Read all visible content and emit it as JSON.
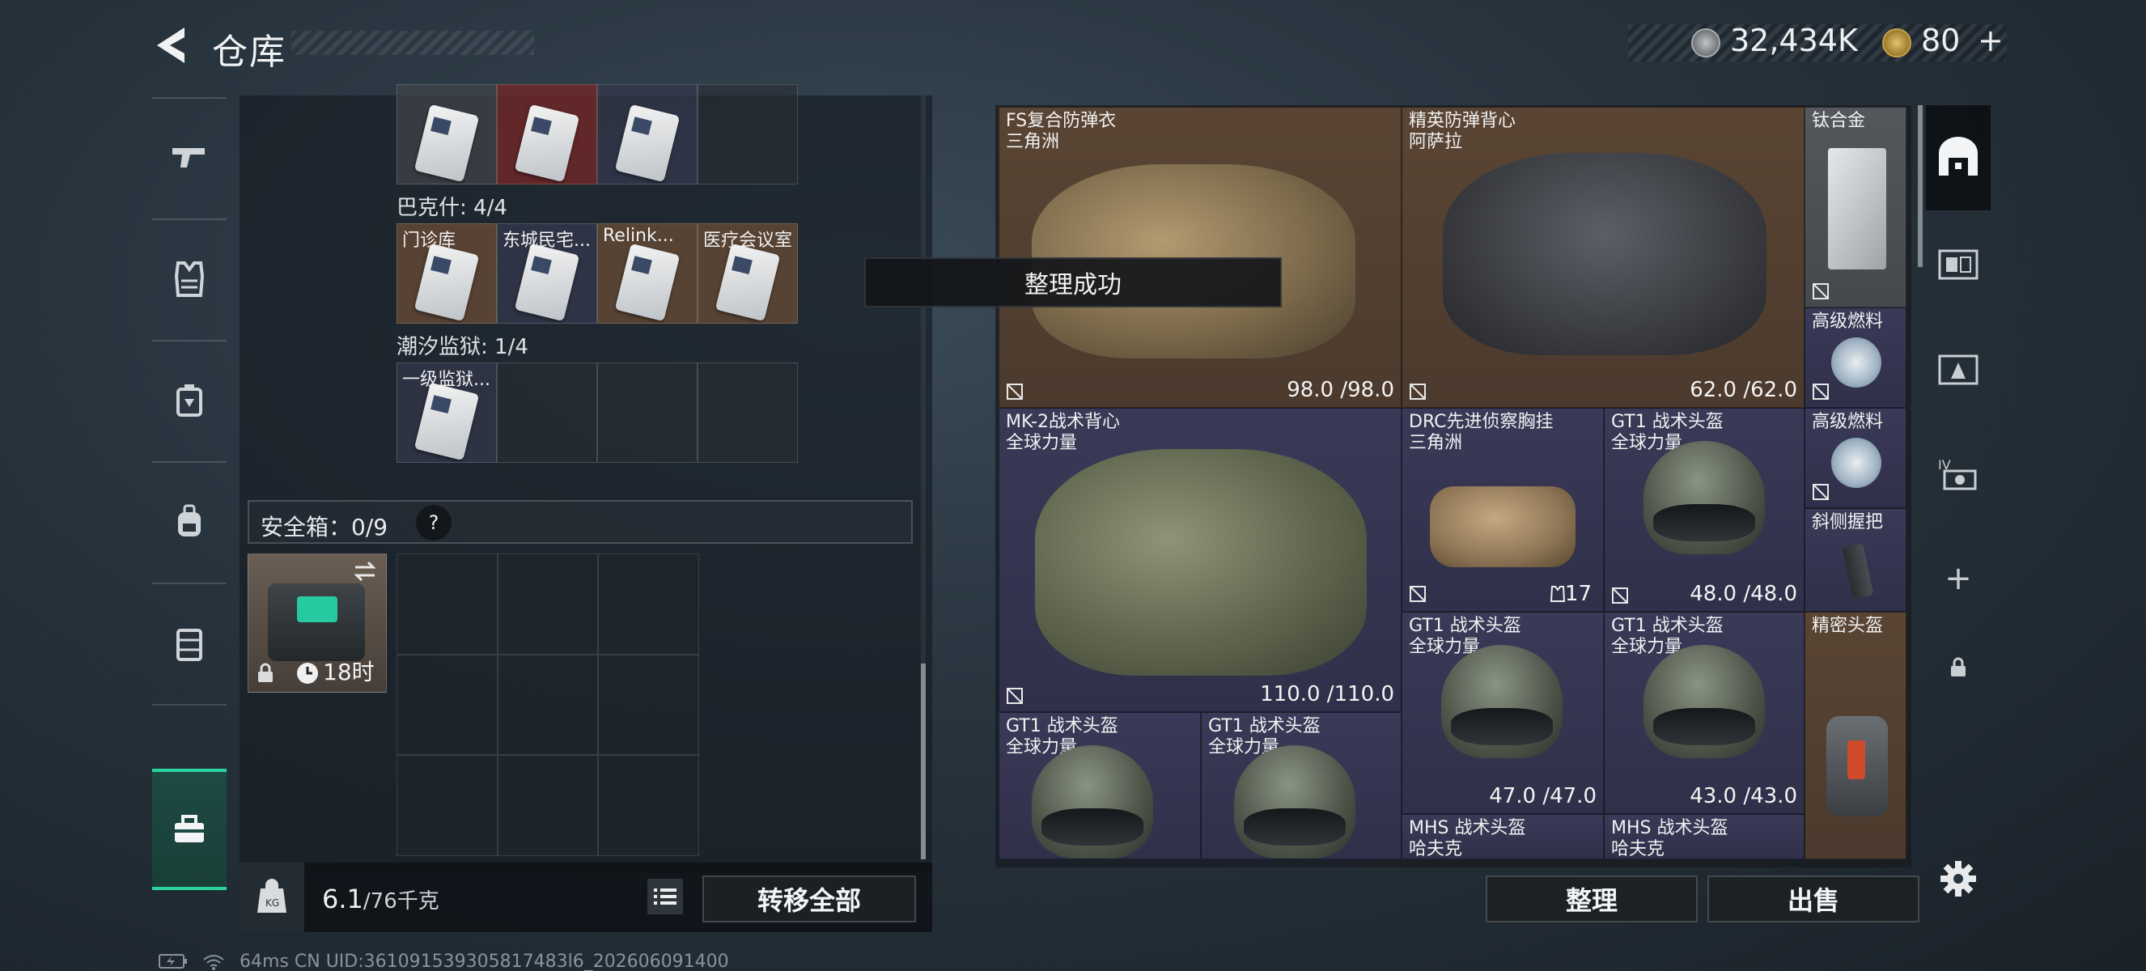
{
  "header": {
    "title": "仓库",
    "currency_silver": "32,434K",
    "currency_gold": "80",
    "add_symbol": "+"
  },
  "left_nav": {
    "items": [
      "weapons-icon",
      "armor-icon",
      "backpack-icon",
      "bag-icon",
      "container-icon",
      "toolbox-icon"
    ]
  },
  "left_panel": {
    "rows": [
      {
        "cells": [
          {
            "label": "",
            "kind": "keycard"
          },
          {
            "label": "",
            "kind": "keycard"
          },
          {
            "label": "",
            "kind": "keycard"
          },
          {
            "label": "",
            "kind": "empty"
          }
        ]
      },
      {
        "section": "巴克什: 4/4",
        "cells": [
          {
            "label": "门诊库"
          },
          {
            "label": "东城民宅..."
          },
          {
            "label": "Relink..."
          },
          {
            "label": "医疗会议室"
          }
        ]
      },
      {
        "section": "潮汐监狱: 1/4",
        "cells": [
          {
            "label": "一级监狱..."
          }
        ]
      }
    ],
    "safe_label": "安全箱：0/9",
    "help": "?",
    "safebox_timer": "18时"
  },
  "bottom_left": {
    "weight_current": "6.1",
    "weight_max": "/76千克",
    "transfer_all": "转移全部"
  },
  "items": [
    {
      "name": "FS复合防弹衣",
      "sub": "三角洲",
      "dur": "98.0 /98.0"
    },
    {
      "name": "精英防弹背心",
      "sub": "阿萨拉",
      "dur": "62.0 /62.0"
    },
    {
      "name": "钛合金",
      "sub": "",
      "dur": ""
    },
    {
      "name": "高级燃料",
      "sub": "",
      "dur": ""
    },
    {
      "name": "MK-2战术背心",
      "sub": "全球力量",
      "dur": "110.0 /110.0"
    },
    {
      "name": "DRC先进侦察胸挂",
      "sub": "三角洲",
      "dur": "17"
    },
    {
      "name": "GT1 战术头盔",
      "sub": "全球力量",
      "dur": "48.0 /48.0"
    },
    {
      "name": "高级燃料",
      "sub": "",
      "dur": ""
    },
    {
      "name": "斜侧握把",
      "sub": "",
      "dur": ""
    },
    {
      "name": "GT1 战术头盔",
      "sub": "全球力量",
      "dur": "47.0 /47.0"
    },
    {
      "name": "GT1 战术头盔",
      "sub": "全球力量",
      "dur": "43.0 /43.0"
    },
    {
      "name": "精密头盔",
      "sub": "",
      "dur": ""
    },
    {
      "name": "GT1 战术头盔",
      "sub": "全球力量",
      "dur": ""
    },
    {
      "name": "GT1 战术头盔",
      "sub": "全球力量",
      "dur": ""
    },
    {
      "name": "MHS 战术头盔",
      "sub": "哈夫克",
      "dur": ""
    },
    {
      "name": "MHS 战术头盔",
      "sub": "哈夫克",
      "dur": ""
    }
  ],
  "toast": "整理成功",
  "actions": {
    "sort": "整理",
    "sell": "出售"
  },
  "right_nav": {
    "add": "+"
  },
  "status_bar": "64ms    CN UID:361091539305817483l6_202606091400"
}
